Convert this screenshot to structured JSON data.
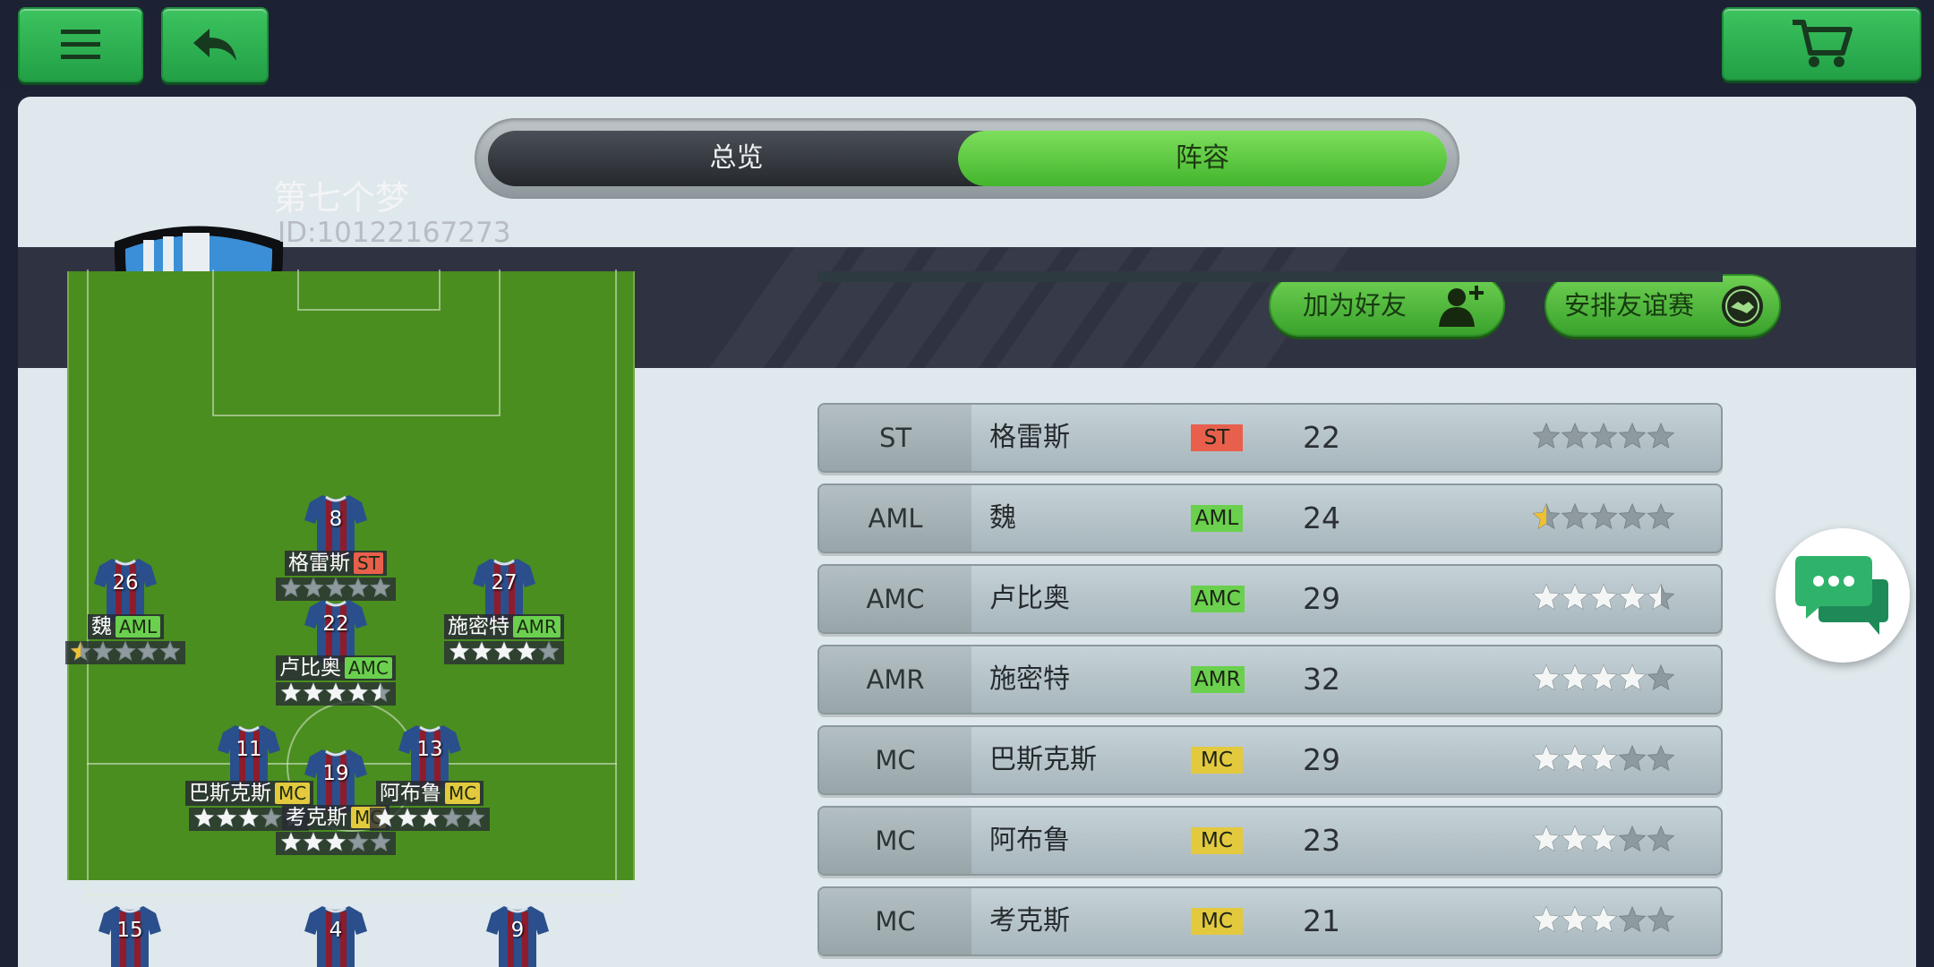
{
  "colors": {
    "green": "#3cc35f",
    "st": "#e8604c",
    "aml": "#6ad04e",
    "mc": "#e3c93d"
  },
  "top": {
    "menu_icon": "menu-icon",
    "back_icon": "back-arrow-icon",
    "cart_icon": "cart-icon"
  },
  "tabs": {
    "overview": "总览",
    "squad": "阵容",
    "active": "squad"
  },
  "team": {
    "name": "第七个梦",
    "id": "ID:10122167273",
    "crest": "shield-crest"
  },
  "actions": {
    "add_friend": "加为好友",
    "arrange_friendly": "安排友谊赛"
  },
  "pitch_players": [
    {
      "number": "8",
      "name": "格雷斯",
      "pos": "ST",
      "rating": 0
    },
    {
      "number": "26",
      "name": "魏",
      "pos": "AML",
      "rating": 0.5
    },
    {
      "number": "27",
      "name": "施密特",
      "pos": "AMR",
      "rating": 4
    },
    {
      "number": "22",
      "name": "卢比奥",
      "pos": "AMC",
      "rating": 4.5
    },
    {
      "number": "11",
      "name": "巴斯克斯",
      "pos": "MC",
      "rating": 3
    },
    {
      "number": "19",
      "name": "考克斯",
      "pos": "MC",
      "rating": 3
    },
    {
      "number": "13",
      "name": "阿布鲁",
      "pos": "MC",
      "rating": 3
    },
    {
      "number": "15",
      "name": "",
      "pos": "",
      "rating": 0
    },
    {
      "number": "4",
      "name": "",
      "pos": "",
      "rating": 0
    },
    {
      "number": "9",
      "name": "",
      "pos": "",
      "rating": 0
    }
  ],
  "squad": [
    {
      "slot": "ST",
      "name": "格雷斯",
      "pos": "ST",
      "age": "22",
      "rating": 0
    },
    {
      "slot": "AML",
      "name": "魏",
      "pos": "AML",
      "age": "24",
      "rating": 0.5
    },
    {
      "slot": "AMC",
      "name": "卢比奥",
      "pos": "AMC",
      "age": "29",
      "rating": 4.5
    },
    {
      "slot": "AMR",
      "name": "施密特",
      "pos": "AMR",
      "age": "32",
      "rating": 4
    },
    {
      "slot": "MC",
      "name": "巴斯克斯",
      "pos": "MC",
      "age": "29",
      "rating": 3
    },
    {
      "slot": "MC",
      "name": "阿布鲁",
      "pos": "MC",
      "age": "23",
      "rating": 3
    },
    {
      "slot": "MC",
      "name": "考克斯",
      "pos": "MC",
      "age": "21",
      "rating": 3
    }
  ]
}
